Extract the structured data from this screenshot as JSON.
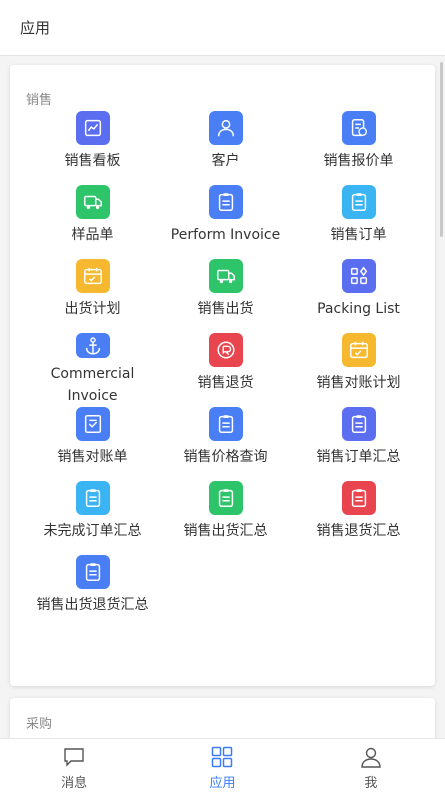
{
  "header": {
    "title": "应用"
  },
  "sales": {
    "title": "销售",
    "items": [
      {
        "label": "销售看板",
        "color": "#5b6ef0",
        "icon": "chart"
      },
      {
        "label": "客户",
        "color": "#4a7ef5",
        "icon": "person"
      },
      {
        "label": "销售报价单",
        "color": "#4a7ef5",
        "icon": "quote"
      },
      {
        "label": "样品单",
        "color": "#2ec46a",
        "icon": "truck"
      },
      {
        "label": "Perform Invoice",
        "color": "#4a7ef5",
        "icon": "clipboard"
      },
      {
        "label": "销售订单",
        "color": "#3ab4f2",
        "icon": "clipboard"
      },
      {
        "label": "出货计划",
        "color": "#f5b82e",
        "icon": "calendar"
      },
      {
        "label": "销售出货",
        "color": "#2ec46a",
        "icon": "truck"
      },
      {
        "label": "Packing List",
        "color": "#5b6ef0",
        "icon": "grid"
      },
      {
        "label": "Commercial Invoice",
        "color": "#4a7ef5",
        "icon": "anchor"
      },
      {
        "label": "销售退货",
        "color": "#e8454f",
        "icon": "return"
      },
      {
        "label": "销售对账计划",
        "color": "#f5b82e",
        "icon": "calendar"
      },
      {
        "label": "销售对账单",
        "color": "#4a7ef5",
        "icon": "statement"
      },
      {
        "label": "销售价格查询",
        "color": "#4a7ef5",
        "icon": "clipboard"
      },
      {
        "label": "销售订单汇总",
        "color": "#5b6ef0",
        "icon": "clipboard"
      },
      {
        "label": "未完成订单汇总",
        "color": "#3ab4f2",
        "icon": "clipboard"
      },
      {
        "label": "销售出货汇总",
        "color": "#2ec46a",
        "icon": "clipboard"
      },
      {
        "label": "销售退货汇总",
        "color": "#e8454f",
        "icon": "clipboard"
      },
      {
        "label": "销售出货退货汇总",
        "color": "#4a7ef5",
        "icon": "clipboard"
      }
    ]
  },
  "purchase": {
    "title": "采购"
  },
  "tabbar": {
    "items": [
      {
        "label": "消息",
        "icon": "message"
      },
      {
        "label": "应用",
        "icon": "apps",
        "active": true
      },
      {
        "label": "我",
        "icon": "user"
      }
    ],
    "active_color": "#3b7cf5"
  }
}
